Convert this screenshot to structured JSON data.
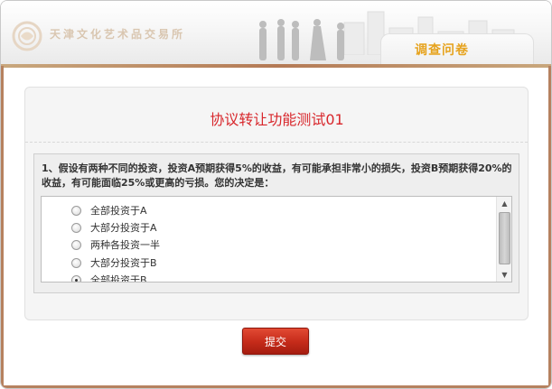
{
  "header": {
    "brand": "天津文化艺术品交易所",
    "tab_label": "调查问卷"
  },
  "panel": {
    "title": "协议转让功能测试01"
  },
  "question": {
    "text": "1、假设有两种不同的投资，投资A预期获得5%的收益，有可能承担非常小的损失，投资B预期获得20%的收益，有可能面临25%或更高的亏损。您的决定是：",
    "options": [
      "全部投资于A",
      "大部分投资于A",
      "两种各投资一半",
      "大部分投资于B",
      "全部投资于B"
    ],
    "selected_index": 4
  },
  "scrollbar": {
    "up_icon": "▲",
    "down_icon": "▼"
  },
  "actions": {
    "submit_label": "提交"
  },
  "colors": {
    "title": "#d8262b",
    "tab_label": "#e6a31e",
    "submit": "#c42a19"
  }
}
